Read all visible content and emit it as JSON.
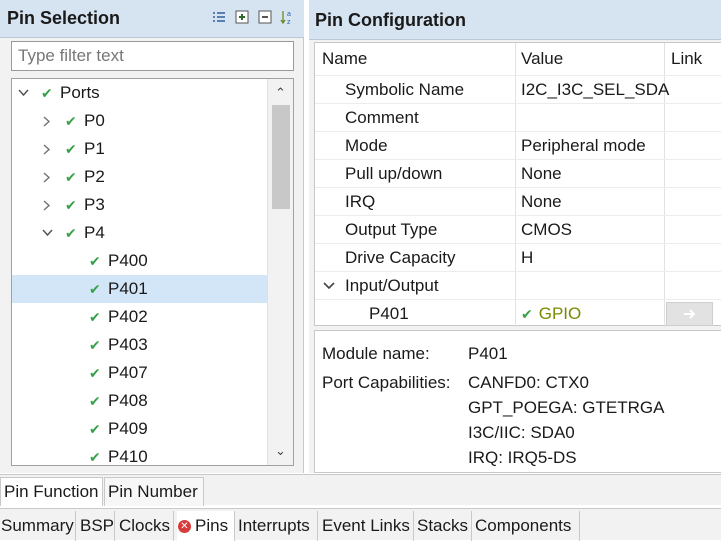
{
  "pin_selection": {
    "title": "Pin Selection",
    "toolbar_icons": [
      "list-view-icon",
      "expand-all-icon",
      "collapse-all-icon",
      "sort-az-icon"
    ],
    "filter_placeholder": "Type filter text",
    "tree": [
      {
        "label": "Ports",
        "level": 0,
        "twisty": "expanded",
        "checked": true
      },
      {
        "label": "P0",
        "level": 1,
        "twisty": "collapsed",
        "checked": true
      },
      {
        "label": "P1",
        "level": 1,
        "twisty": "collapsed",
        "checked": true
      },
      {
        "label": "P2",
        "level": 1,
        "twisty": "collapsed",
        "checked": true
      },
      {
        "label": "P3",
        "level": 1,
        "twisty": "collapsed",
        "checked": true
      },
      {
        "label": "P4",
        "level": 1,
        "twisty": "expanded",
        "checked": true
      },
      {
        "label": "P400",
        "level": 2,
        "checked": true
      },
      {
        "label": "P401",
        "level": 2,
        "checked": true,
        "selected": true
      },
      {
        "label": "P402",
        "level": 2,
        "checked": true
      },
      {
        "label": "P403",
        "level": 2,
        "checked": true
      },
      {
        "label": "P407",
        "level": 2,
        "checked": true
      },
      {
        "label": "P408",
        "level": 2,
        "checked": true
      },
      {
        "label": "P409",
        "level": 2,
        "checked": true
      },
      {
        "label": "P410",
        "level": 2,
        "checked": true
      }
    ]
  },
  "pin_configuration": {
    "title": "Pin Configuration",
    "columns": {
      "name": "Name",
      "value": "Value",
      "link": "Link"
    },
    "rows": [
      {
        "name": "Symbolic Name",
        "value": "I2C_I3C_SEL_SDA"
      },
      {
        "name": "Comment",
        "value": ""
      },
      {
        "name": "Mode",
        "value": "Peripheral mode"
      },
      {
        "name": "Pull up/down",
        "value": "None"
      },
      {
        "name": "IRQ",
        "value": "None"
      },
      {
        "name": "Output Type",
        "value": "CMOS"
      },
      {
        "name": "Drive Capacity",
        "value": "H"
      },
      {
        "name": "Input/Output",
        "value": ""
      },
      {
        "name": "P401",
        "value": "GPIO"
      }
    ],
    "module": {
      "name_label": "Module name:",
      "name_value": "P401",
      "caps_label": "Port Capabilities:",
      "caps": [
        "CANFD0: CTX0",
        "GPT_POEGA: GTETRGA",
        "I3C/IIC: SDA0",
        "IRQ: IRQ5-DS"
      ]
    }
  },
  "view_tabs": [
    "Pin Function",
    "Pin Number"
  ],
  "editor_tabs": [
    "Summary",
    "BSP",
    "Clocks",
    "Pins",
    "Interrupts",
    "Event Links",
    "Stacks",
    "Components"
  ],
  "colors": {
    "accent_header": "#d6e4f2",
    "selection": "#d2e6f8",
    "check": "#3aa14a",
    "gpio_text": "#7a8a00",
    "error": "#d83b3b"
  }
}
